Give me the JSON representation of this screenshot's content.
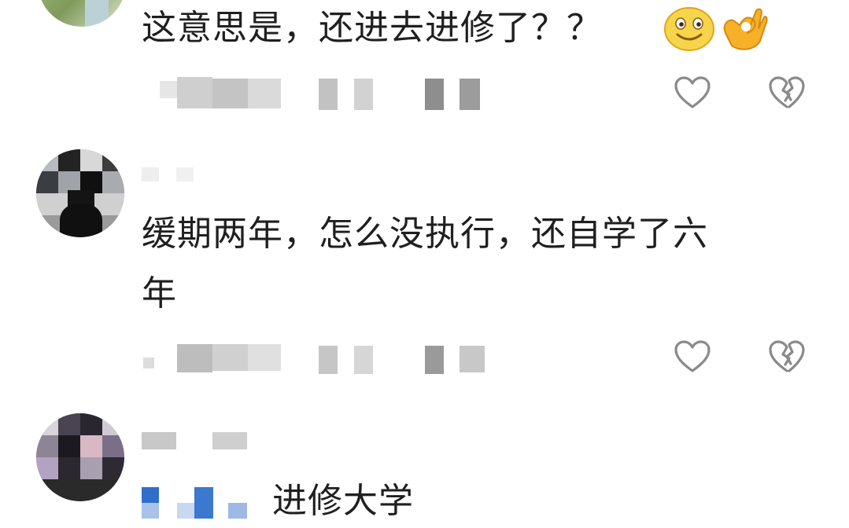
{
  "comments": [
    {
      "text": "这意思是，还进去进修了？？",
      "emojis": [
        "smiling-face-emoji",
        "ok-hand-emoji"
      ],
      "actions": [
        "like-icon",
        "dislike-icon"
      ]
    },
    {
      "text_line1": "缓期两年，怎么没执行，还自学了六",
      "text_line2": "年",
      "actions": [
        "like-icon",
        "dislike-icon"
      ]
    },
    {
      "text": "进修大学"
    }
  ],
  "colors": {
    "text": "#1f1f1f",
    "icon": "#8a8a8a",
    "blur_light": "#e4e4e4",
    "blur_mid": "#c9c9c9",
    "blur_dark": "#8e8e8e"
  }
}
